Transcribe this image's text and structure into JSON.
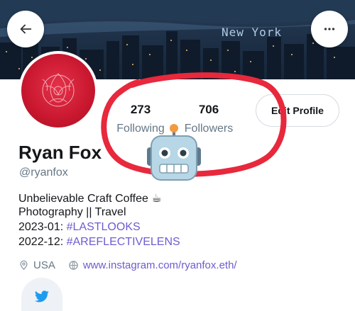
{
  "header": {
    "cover_caption": "New York",
    "back_icon": "arrow-left-icon",
    "more_icon": "more-horizontal-icon"
  },
  "profile": {
    "name": "Ryan Fox",
    "handle": "@ryanfox",
    "stats": {
      "following_count": "273",
      "following_label": "Following",
      "followers_count": "706",
      "followers_label": "Followers"
    },
    "edit_button_label": "Edit Profile",
    "bio": {
      "line1": "Unbelievable Craft Coffee ☕",
      "line2": "Photography || Travel",
      "line3_prefix": "2023-01: ",
      "line3_tag": "#LASTLOOKS",
      "line4_prefix": "2022-12: ",
      "line4_tag": "#AREFLECTIVELENS"
    },
    "location": "USA",
    "website": "www.instagram.com/ryanfox.eth/",
    "social_icon": "twitter-icon"
  },
  "colors": {
    "accent_link": "#6e5cd1",
    "annotation_red": "#e8283c",
    "avatar_red": "#c8172f",
    "twitter_blue": "#1d9bf0",
    "muted_text": "#657786"
  },
  "overlay": {
    "sticker_icon": "robot-face-icon"
  }
}
